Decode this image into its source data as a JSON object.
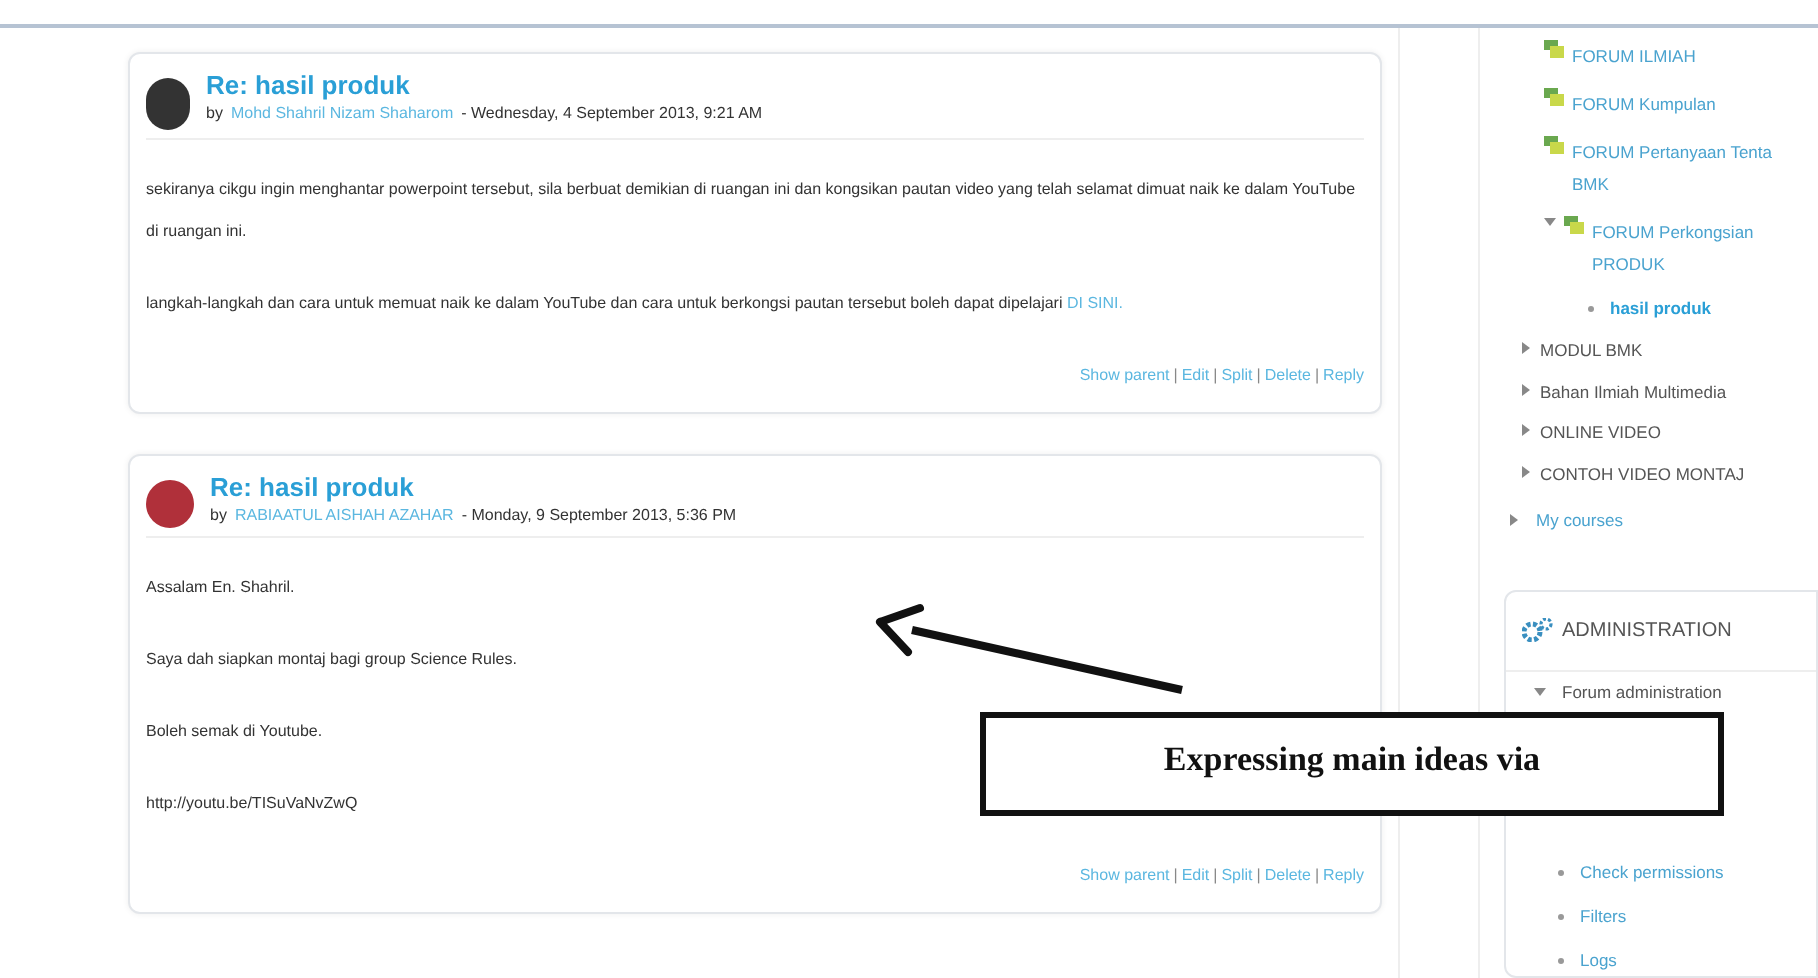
{
  "posts": [
    {
      "title": "Re: hasil produk",
      "by": "by",
      "author": "Mohd Shahril Nizam Shaharom",
      "date": "- Wednesday, 4 September 2013, 9:21 AM",
      "paragraphs": [
        {
          "text": "sekiranya cikgu ingin menghantar powerpoint tersebut, sila berbuat demikian di ruangan ini dan kongsikan pautan video yang telah selamat dimuat naik ke dalam YouTube di ruangan ini."
        },
        {
          "text": "langkah-langkah dan cara untuk memuat naik ke dalam YouTube dan cara untuk berkongsi pautan tersebut boleh dapat dipelajari",
          "link": "DI SINI."
        }
      ],
      "separator": "|",
      "actions": [
        "Show parent",
        "Edit",
        "Split",
        "Delete",
        "Reply"
      ]
    },
    {
      "title": "Re: hasil produk",
      "by": "by",
      "author": "RABIAATUL AISHAH AZAHAR",
      "date": "- Monday, 9 September 2013, 5:36 PM",
      "paragraphs": [
        {
          "text": "Assalam En. Shahril."
        },
        {
          "text": "Saya dah siapkan montaj bagi group Science Rules."
        },
        {
          "text": "Boleh semak di Youtube."
        },
        {
          "text": "http://youtu.be/TISuVaNvZwQ"
        }
      ],
      "separator": "|",
      "actions": [
        "Show parent",
        "Edit",
        "Split",
        "Delete",
        "Reply"
      ]
    }
  ],
  "navigation": {
    "items": [
      {
        "kind": "forum",
        "lines": [
          "FORUM ILMIAH"
        ],
        "expanded": false
      },
      {
        "kind": "forum",
        "lines": [
          "FORUM Kumpulan"
        ],
        "expanded": false
      },
      {
        "kind": "forum",
        "lines": [
          "FORUM Pertanyaan Tenta",
          "BMK"
        ],
        "expanded": false
      },
      {
        "kind": "forum",
        "lines": [
          "FORUM Perkongsian",
          "PRODUK"
        ],
        "expanded": true,
        "children": [
          {
            "label": "hasil produk",
            "selected": true
          }
        ]
      },
      {
        "kind": "section",
        "lines": [
          "MODUL BMK"
        ],
        "expanded": false
      },
      {
        "kind": "section",
        "lines": [
          "Bahan Ilmiah Multimedia"
        ],
        "expanded": false
      },
      {
        "kind": "section",
        "lines": [
          "ONLINE VIDEO"
        ],
        "expanded": false
      },
      {
        "kind": "section",
        "lines": [
          "CONTOH VIDEO MONTAJ"
        ],
        "expanded": false
      }
    ],
    "root_items": [
      {
        "label": "My courses",
        "expanded": false
      }
    ]
  },
  "administration": {
    "title": "ADMINISTRATION",
    "tree": [
      {
        "label": "Forum administration",
        "expanded": true,
        "children": [
          {
            "label": "Check permissions"
          },
          {
            "label": "Filters"
          },
          {
            "label": "Logs"
          }
        ]
      }
    ]
  },
  "annotation": {
    "text": "Expressing main ideas via"
  }
}
